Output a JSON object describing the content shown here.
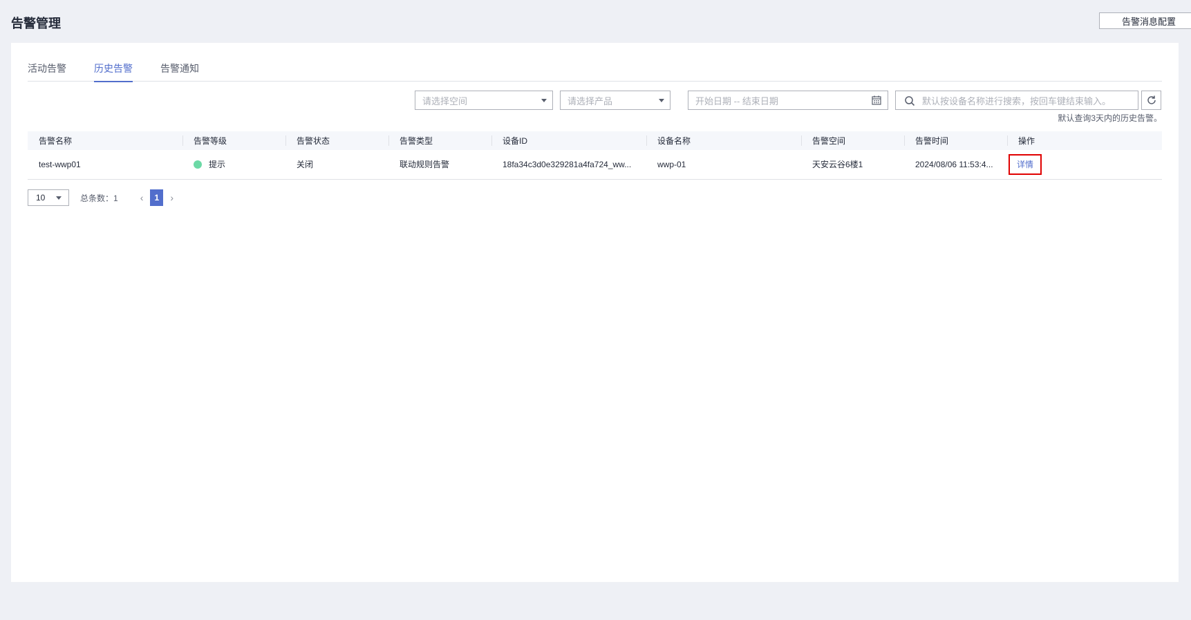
{
  "header": {
    "title": "告警管理",
    "config_button": "告警消息配置"
  },
  "tabs": [
    {
      "label": "活动告警",
      "active": false
    },
    {
      "label": "历史告警",
      "active": true
    },
    {
      "label": "告警通知",
      "active": false
    }
  ],
  "filters": {
    "space_placeholder": "请选择空间",
    "product_placeholder": "请选择产品",
    "date_placeholder": "开始日期 -- 结束日期",
    "search_placeholder": "默认按设备名称进行搜索，按回车键结束输入。",
    "hint": "默认查询3天内的历史告警。"
  },
  "table": {
    "columns": [
      "告警名称",
      "告警等级",
      "告警状态",
      "告警类型",
      "设备ID",
      "设备名称",
      "告警空间",
      "告警时间",
      "操作"
    ],
    "rows": [
      {
        "name": "test-wwp01",
        "level": "提示",
        "level_color": "#6cd9a6",
        "status": "关闭",
        "type": "联动规则告警",
        "device_id": "18fa34c3d0e329281a4fa724_ww...",
        "device_name": "wwp-01",
        "space": "天安云谷6楼1",
        "time": "2024/08/06 11:53:4...",
        "action": "详情"
      }
    ]
  },
  "pagination": {
    "page_size": "10",
    "total_label": "总条数：1",
    "current_page": "1",
    "prev": "‹",
    "next": "›"
  },
  "colors": {
    "accent": "#526ecc",
    "highlight_border": "#e00000",
    "page_bg": "#eef0f5"
  }
}
